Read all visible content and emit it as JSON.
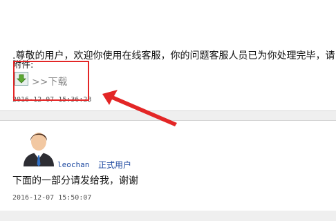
{
  "thread": {
    "posts": [
      {
        "message": ".尊敬的用户，欢迎你使用在线客服，你的问题客服人员已为你处理完毕，请",
        "attachment_label": "附件:",
        "download_link": ">>下载",
        "timestamp": "2016-12-07 15:36:23"
      },
      {
        "username": "leochan",
        "user_role": "正式用户",
        "message": "下面的一部分请发给我，谢谢",
        "timestamp": "2016-12-07 15:50:07"
      }
    ]
  },
  "annotation": {
    "box_color": "#e32626",
    "arrow_color": "#e32626"
  },
  "icons": {
    "download": "download-icon",
    "avatar": "user-avatar"
  }
}
